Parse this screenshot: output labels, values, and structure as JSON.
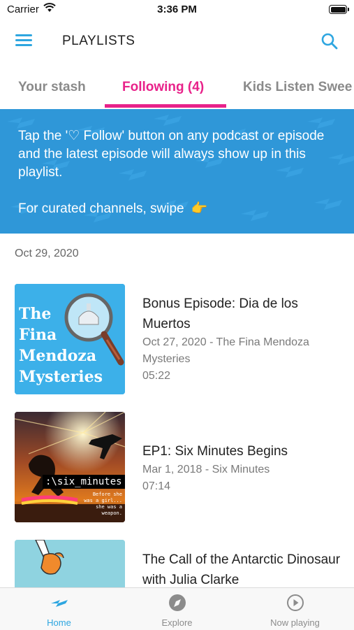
{
  "status_bar": {
    "carrier": "Carrier",
    "time": "3:36 PM"
  },
  "header": {
    "title": "PLAYLISTS"
  },
  "tabs": [
    {
      "label": "Your stash",
      "active": false
    },
    {
      "label": "Following (4)",
      "active": true
    },
    {
      "label": "Kids Listen Swee",
      "active": false
    }
  ],
  "banner": {
    "line1": "Tap the '♡ Follow' button on any podcast or episode and the latest episode will always show up in this playlist.",
    "line2": "For curated channels, swipe",
    "emoji": "👉"
  },
  "section": {
    "date": "Oct 29, 2020"
  },
  "episodes": [
    {
      "title": "Bonus Episode: Dia de los Muertos",
      "meta": "Oct 27, 2020 - The Fina Mendoza Mysteries",
      "duration": "05:22",
      "art_text": [
        "The",
        "Fina",
        "Mendoza",
        "Mysteries"
      ]
    },
    {
      "title": "EP1: Six Minutes Begins",
      "meta": "Mar 1, 2018 - Six Minutes",
      "duration": "07:14",
      "art_text": ":\\six_minutes",
      "art_caption": "Before she was a girl... she was a weapon."
    },
    {
      "title": "The Call of the Antarctic Dinosaur with Julia Clarke",
      "meta": "",
      "duration": ""
    }
  ],
  "bottom_nav": [
    {
      "label": "Home",
      "icon": "home-wave-icon",
      "active": true
    },
    {
      "label": "Explore",
      "icon": "compass-icon",
      "active": false
    },
    {
      "label": "Now playing",
      "icon": "play-circle-icon",
      "active": false
    }
  ],
  "colors": {
    "accent_blue": "#2ea6e0",
    "accent_pink": "#e8228a",
    "banner_blue": "#2f97d8"
  }
}
